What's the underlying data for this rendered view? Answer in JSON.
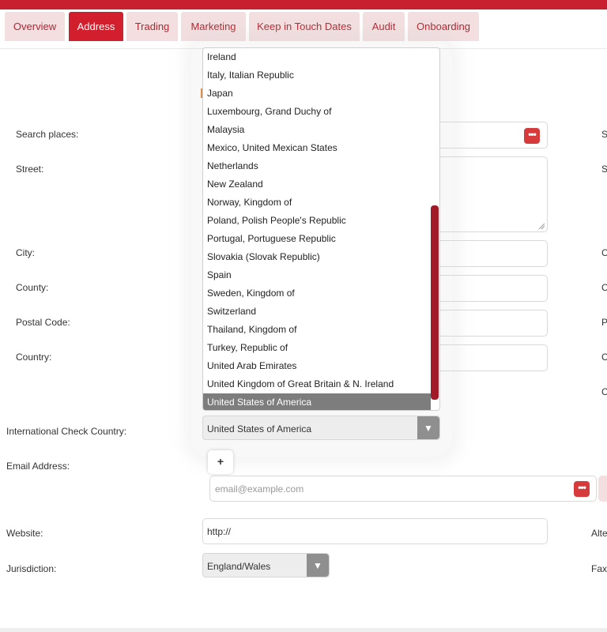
{
  "tabs": [
    {
      "label": "Overview"
    },
    {
      "label": "Address"
    },
    {
      "label": "Trading"
    },
    {
      "label": "Marketing"
    },
    {
      "label": "Keep in Touch Dates"
    },
    {
      "label": "Audit"
    },
    {
      "label": "Onboarding"
    }
  ],
  "active_tab": "Address",
  "form": {
    "search_places_label": "Search places:",
    "street_label": "Street:",
    "city_label": "City:",
    "county_label": "County:",
    "postal_code_label": "Postal Code:",
    "country_label": "Country:",
    "intl_check_country_label": "International Check Country:",
    "email_label": "Email Address:",
    "email_placeholder": "email@example.com",
    "website_label": "Website:",
    "website_value": "http://",
    "jurisdiction_label": "Jurisdiction:",
    "jurisdiction_value": "England/Wales",
    "intl_check_country_value": "United States of America",
    "add_button_label": "+",
    "dots_label": "•••"
  },
  "right_column_labels": {
    "r1": "S",
    "r2": "S",
    "r3": "C",
    "r4": "C",
    "r5": "P",
    "r6": "C",
    "r7": "C",
    "alt": "Alte",
    "fax": "Fax"
  },
  "dropdown": {
    "items": [
      "Ireland",
      "Italy, Italian Republic",
      "Japan",
      "Luxembourg, Grand Duchy of",
      "Malaysia",
      "Mexico, United Mexican States",
      "Netherlands",
      "New Zealand",
      "Norway, Kingdom of",
      "Poland, Polish People's Republic",
      "Portugal, Portuguese Republic",
      "Slovakia (Slovak Republic)",
      "Spain",
      "Sweden, Kingdom of",
      "Switzerland",
      "Thailand, Kingdom of",
      "Turkey, Republic of",
      "United Arab Emirates",
      "United Kingdom of Great Britain & N. Ireland",
      "United States of America"
    ],
    "selected": "United States of America"
  },
  "colors": {
    "brand": "#c8202e",
    "active_tab": "#d11f2d",
    "tab_bg": "#f3dfe0",
    "scroll_thumb": "#a01a28",
    "selected_item": "#7d7d7d"
  }
}
